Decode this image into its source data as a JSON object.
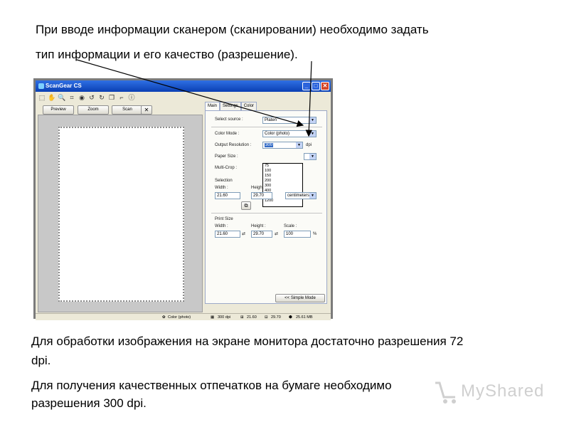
{
  "slide": {
    "heading_line1": "При вводе информации сканером (сканировании) необходимо задать",
    "heading_line2": "тип информации и его качество (разрешение).",
    "note1_line1": "Для обработки изображения на экране монитора достаточно разрешения 72",
    "note1_line2": "dpi.",
    "note2_line1": "Для получения качественных отпечатков на бумаге необходимо",
    "note2_line2": "разрешения 300 dpi."
  },
  "window": {
    "title": "ScanGear CS",
    "buttons": {
      "preview": "Preview",
      "zoom": "Zoom",
      "scan": "Scan",
      "close_x": "✕"
    },
    "tabs": [
      "Main",
      "Settings",
      "Color"
    ],
    "settings": {
      "select_source_label": "Select source :",
      "select_source_value": "Platen",
      "color_mode_label": "Color Mode :",
      "color_mode_value": "Color (photo)",
      "output_resolution_label": "Output Resolution :",
      "output_resolution_value": "300",
      "output_resolution_unit": "dpi",
      "resolution_options": [
        "75",
        "100",
        "150",
        "200",
        "300",
        "400",
        "600",
        "1200"
      ],
      "paper_size_label": "Paper Size :",
      "multi_crop_label": "Multi-Crop :",
      "selection_label": "Selection",
      "width_label": "Width :",
      "height_label": "Height",
      "selection_width": "21.60",
      "selection_height": "29.70",
      "unit_value": "centimeters",
      "print_size_label": "Print Size",
      "print_width_label": "Width :",
      "print_height_label": "Height :",
      "scale_label": "Scale :",
      "print_width": "21.60",
      "print_height": "29.70",
      "scale_value": "100",
      "scale_unit": "%",
      "simple_mode": "<< Simple Mode"
    },
    "status": {
      "color_mode": "Color (photo)",
      "resolution": "300 dpi",
      "width": "21.60",
      "height": "29.70",
      "size": "25.61 MB"
    }
  },
  "watermark": {
    "text": "MyShared"
  }
}
